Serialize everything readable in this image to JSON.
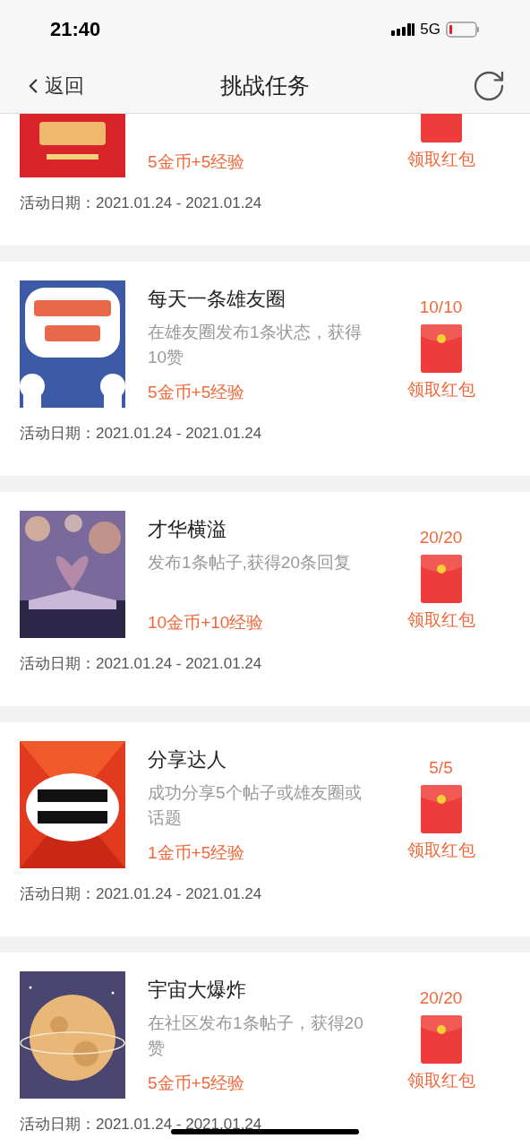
{
  "status_bar": {
    "time": "21:40",
    "network": "5G"
  },
  "nav": {
    "back": "返回",
    "title": "挑战任务"
  },
  "tasks": [
    {
      "reward": "5金币+5经验",
      "claim": "领取红包",
      "date_label": "活动日期：",
      "date": "2021.01.24 - 2021.01.24"
    },
    {
      "title": "每天一条雄友圈",
      "description": "在雄友圈发布1条状态，获得10赞",
      "reward": "5金币+5经验",
      "progress": "10/10",
      "claim": "领取红包",
      "date_label": "活动日期：",
      "date": "2021.01.24 - 2021.01.24"
    },
    {
      "title": "才华横溢",
      "description": "发布1条帖子,获得20条回复",
      "reward": "10金币+10经验",
      "progress": "20/20",
      "claim": "领取红包",
      "date_label": "活动日期：",
      "date": "2021.01.24 - 2021.01.24"
    },
    {
      "title": "分享达人",
      "description": "成功分享5个帖子或雄友圈或话题",
      "reward": "1金币+5经验",
      "progress": "5/5",
      "claim": "领取红包",
      "date_label": "活动日期：",
      "date": "2021.01.24 - 2021.01.24"
    },
    {
      "title": "宇宙大爆炸",
      "description": "在社区发布1条帖子，获得20赞",
      "reward": "5金币+5经验",
      "progress": "20/20",
      "claim": "领取红包",
      "date_label": "活动日期：",
      "date": "2021.01.24 - 2021.01.24"
    }
  ]
}
